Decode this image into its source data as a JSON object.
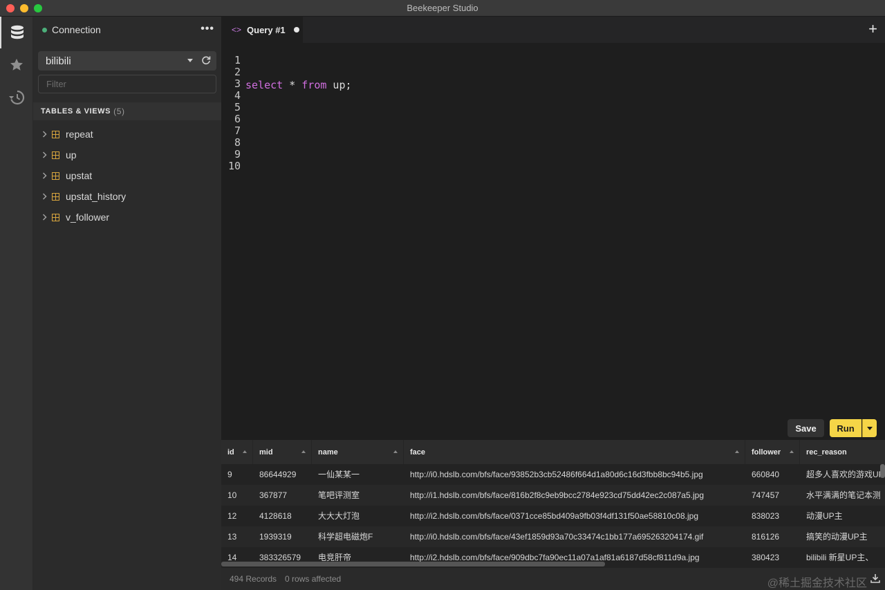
{
  "window": {
    "title": "Beekeeper Studio"
  },
  "rail": {
    "items": [
      "database-icon",
      "star-icon",
      "history-icon"
    ]
  },
  "sidebar": {
    "connection_label": "Connection",
    "more_label": "•••",
    "database": "bilibili",
    "filter_placeholder": "Filter",
    "section_title": "TABLES & VIEWS",
    "section_count": "(5)",
    "tables": [
      "repeat",
      "up",
      "upstat",
      "upstat_history",
      "v_follower"
    ]
  },
  "tabs": [
    {
      "label": "Query #1",
      "code_glyph": "<>"
    }
  ],
  "editor": {
    "line_numbers": [
      "1",
      "2",
      "3",
      "4",
      "5",
      "6",
      "7",
      "8",
      "9",
      "10"
    ],
    "sql": {
      "kw1": "select",
      "star": " * ",
      "kw2": "from",
      "rest": " up;"
    }
  },
  "actions": {
    "save_label": "Save",
    "run_label": "Run"
  },
  "results": {
    "columns": [
      "id",
      "mid",
      "name",
      "face",
      "follower",
      "rec_reason"
    ],
    "rows": [
      [
        "9",
        "86644929",
        "一仙某某一",
        "http://i0.hdslb.com/bfs/face/93852b3cb52486f664d1a80d6c16d3fbb8bc94b5.jpg",
        "660840",
        "超多人喜欢的游戏UP主"
      ],
      [
        "10",
        "367877",
        "笔吧评测室",
        "http://i1.hdslb.com/bfs/face/816b2f8c9eb9bcc2784e923cd75dd42ec2c087a5.jpg",
        "747457",
        "水平满满的笔记本测评"
      ],
      [
        "12",
        "4128618",
        "大大大灯泡",
        "http://i2.hdslb.com/bfs/face/0371cce85bd409a9fb03f4df131f50ae58810c08.jpg",
        "838023",
        "动漫UP主"
      ],
      [
        "13",
        "1939319",
        "科学超电磁炮F",
        "http://i0.hdslb.com/bfs/face/43ef1859d93a70c33474c1bb177a695263204174.gif",
        "816126",
        "搞笑的动漫UP主"
      ],
      [
        "14",
        "383326579",
        "电竞肝帝",
        "http://i2.hdslb.com/bfs/face/909dbc7fa90ec11a07a1af81a6187d58cf811d9a.jpg",
        "380423",
        "bilibili 新星UP主、"
      ]
    ]
  },
  "status": {
    "records": "494 Records",
    "affected": "0 rows affected",
    "watermark": "@稀土掘金技术社区"
  }
}
